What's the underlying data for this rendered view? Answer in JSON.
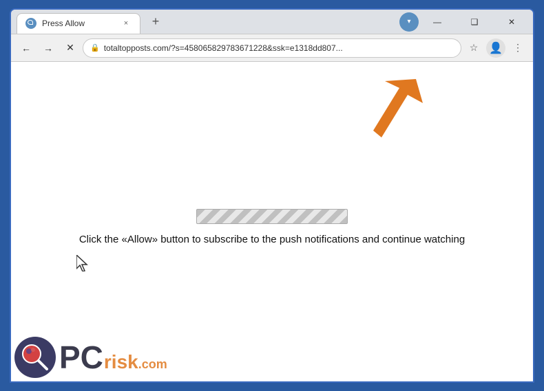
{
  "browser": {
    "title": "Press Allow",
    "tab": {
      "title": "Press Allow",
      "close_label": "×"
    },
    "new_tab_label": "+",
    "window_controls": {
      "minimize": "—",
      "maximize": "❑",
      "close": "✕"
    },
    "nav": {
      "back_label": "←",
      "forward_label": "→",
      "reload_label": "✕",
      "address": "totaltopposts.com/?s=458065829783671228&ssk=e1318dd807...",
      "star_label": "☆",
      "more_label": "⋮"
    }
  },
  "page": {
    "instruction_text": "Click the «Allow» button to subscribe to the push notifications and continue watching",
    "cursor_symbol": "⌖",
    "progress_bar_label": "loading"
  },
  "watermark": {
    "pc_text": "PC",
    "risk_text": "risk",
    "dot_com_text": ".com"
  },
  "colors": {
    "browser_border": "#2a5aa0",
    "orange_arrow": "#e07820",
    "accent": "#5a8fc0"
  }
}
